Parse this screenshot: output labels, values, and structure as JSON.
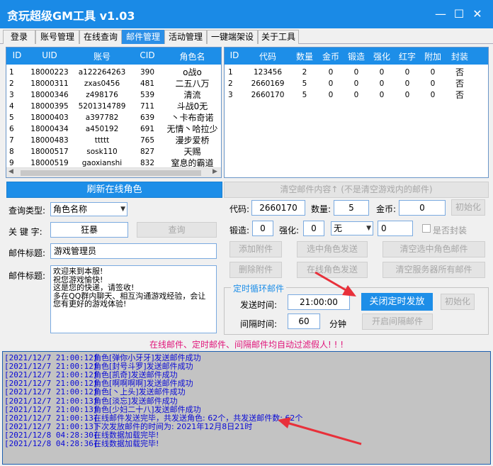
{
  "window": {
    "title": "贪玩超级GM工具 v1.03",
    "minimize": "—",
    "maximize": "☐",
    "close": "✕"
  },
  "tabs": [
    "登录",
    "账号管理",
    "在线查询",
    "邮件管理",
    "活动管理",
    "一键端架设",
    "关于工具"
  ],
  "active_tab": "邮件管理",
  "players": {
    "headers": [
      "ID",
      "UID",
      "账号",
      "CID",
      "角色名"
    ],
    "rows": [
      [
        "1",
        "18000223",
        "a122264263",
        "390",
        "o战o"
      ],
      [
        "2",
        "18000311",
        "zxas0456",
        "481",
        "二五八万"
      ],
      [
        "3",
        "18000346",
        "z498176",
        "539",
        "清流"
      ],
      [
        "4",
        "18000395",
        "5201314789",
        "711",
        "斗战0无"
      ],
      [
        "5",
        "18000403",
        "a397782",
        "639",
        "丶卡布奇诺"
      ],
      [
        "6",
        "18000434",
        "a450192",
        "691",
        "无情丶哈拉少"
      ],
      [
        "7",
        "18000483",
        "ttttt",
        "765",
        "漫步爱桥"
      ],
      [
        "8",
        "18000517",
        "sosk110",
        "827",
        "天赐"
      ],
      [
        "9",
        "18000519",
        "gaoxianshi",
        "832",
        "窒息的霸道"
      ]
    ]
  },
  "attachments": {
    "headers": [
      "ID",
      "代码",
      "数量",
      "金币",
      "锻造",
      "强化",
      "红字",
      "附加",
      "封装"
    ],
    "rows": [
      [
        "1",
        "123456",
        "2",
        "0",
        "0",
        "0",
        "0",
        "0",
        "否"
      ],
      [
        "2",
        "2660169",
        "5",
        "0",
        "0",
        "0",
        "0",
        "0",
        "否"
      ],
      [
        "3",
        "2660170",
        "5",
        "0",
        "0",
        "0",
        "0",
        "0",
        "否"
      ]
    ]
  },
  "left_form": {
    "refresh_button": "刷新在线角色",
    "query_type_label": "查询类型:",
    "query_type_value": "角色名称",
    "keyword_label": "关 键 字:",
    "keyword_value": "狂暴",
    "query_button": "查询",
    "mail_title_label": "邮件标题:",
    "mail_title_value": "游戏管理员",
    "mail_body_label": "邮件标题:",
    "mail_body_lines": [
      "欢迎来到本服!",
      "祝您游戏愉快!",
      "这是您的快递，请签收!",
      "多在QQ群内聊天、相互沟通游戏经验，会让",
      "您有更好的游戏体验!"
    ]
  },
  "right_form": {
    "clear_button": "清空邮件内容↑ (不是清空游戏内的邮件)",
    "code_label": "代码:",
    "code_value": "2660170",
    "qty_label": "数量:",
    "qty_value": "5",
    "gold_label": "金币:",
    "gold_value": "0",
    "init_button": "初始化",
    "forge_label": "锻造:",
    "forge_value": "0",
    "enhance_label": "强化:",
    "enhance_value": "0",
    "extra_select": "无",
    "extra_value": "0",
    "sealed_label": "是否封装",
    "add_attach": "添加附件",
    "send_selected": "选中角色发送",
    "clear_selected": "清空选中角色邮件",
    "del_attach": "删除附件",
    "send_online": "在线角色发送",
    "clear_server": "清空服务器所有邮件",
    "timer_group_title": "定时循环邮件",
    "send_time_label": "发送时间:",
    "send_time_value": "21:00:00",
    "close_timer_button": "关闭定时发放",
    "init_button2": "初始化",
    "interval_label": "间隔时间:",
    "interval_value": "60",
    "interval_unit": "分钟",
    "open_interval_button": "开启间隔邮件"
  },
  "notice": "在线邮件、定时邮件、间隔邮件均自动过滤假人! ! !",
  "log": [
    [
      "2021/12/7  21:00:12]",
      "角色[弹你小牙牙]发送邮件成功"
    ],
    [
      "2021/12/7  21:00:12]",
      "角色[封号斗罗]发送邮件成功"
    ],
    [
      "2021/12/7  21:00:12]",
      "角色[凯奇]发送邮件成功"
    ],
    [
      "2021/12/7  21:00:12]",
      "角色[啊啊啊啊]发送邮件成功"
    ],
    [
      "2021/12/7  21:00:12]",
      "角色[丶上头]发送邮件成功"
    ],
    [
      "2021/12/7  21:00:13]",
      "角色[淡忘]发送邮件成功"
    ],
    [
      "2021/12/7  21:00:13]",
      "角色[少妇二十八]发送邮件成功"
    ],
    [
      "2021/12/7  21:00:13]",
      "在线邮件发送完毕，共发送角色: 62个，共发送邮件数: 62个"
    ],
    [
      "2021/12/7  21:00:13]",
      "下次发放邮件的时间为: 2021年12月8日21时"
    ],
    [
      "2021/12/8  04:28:30]",
      "在线数据加载完毕!"
    ],
    [
      "2021/12/8  04:28:36]",
      "在线数据加载完毕!"
    ]
  ],
  "colors": {
    "accent": "#1d8ee8",
    "log_text": "#0a0ad6",
    "notice": "#e0157a",
    "arrow": "#e8303a"
  }
}
